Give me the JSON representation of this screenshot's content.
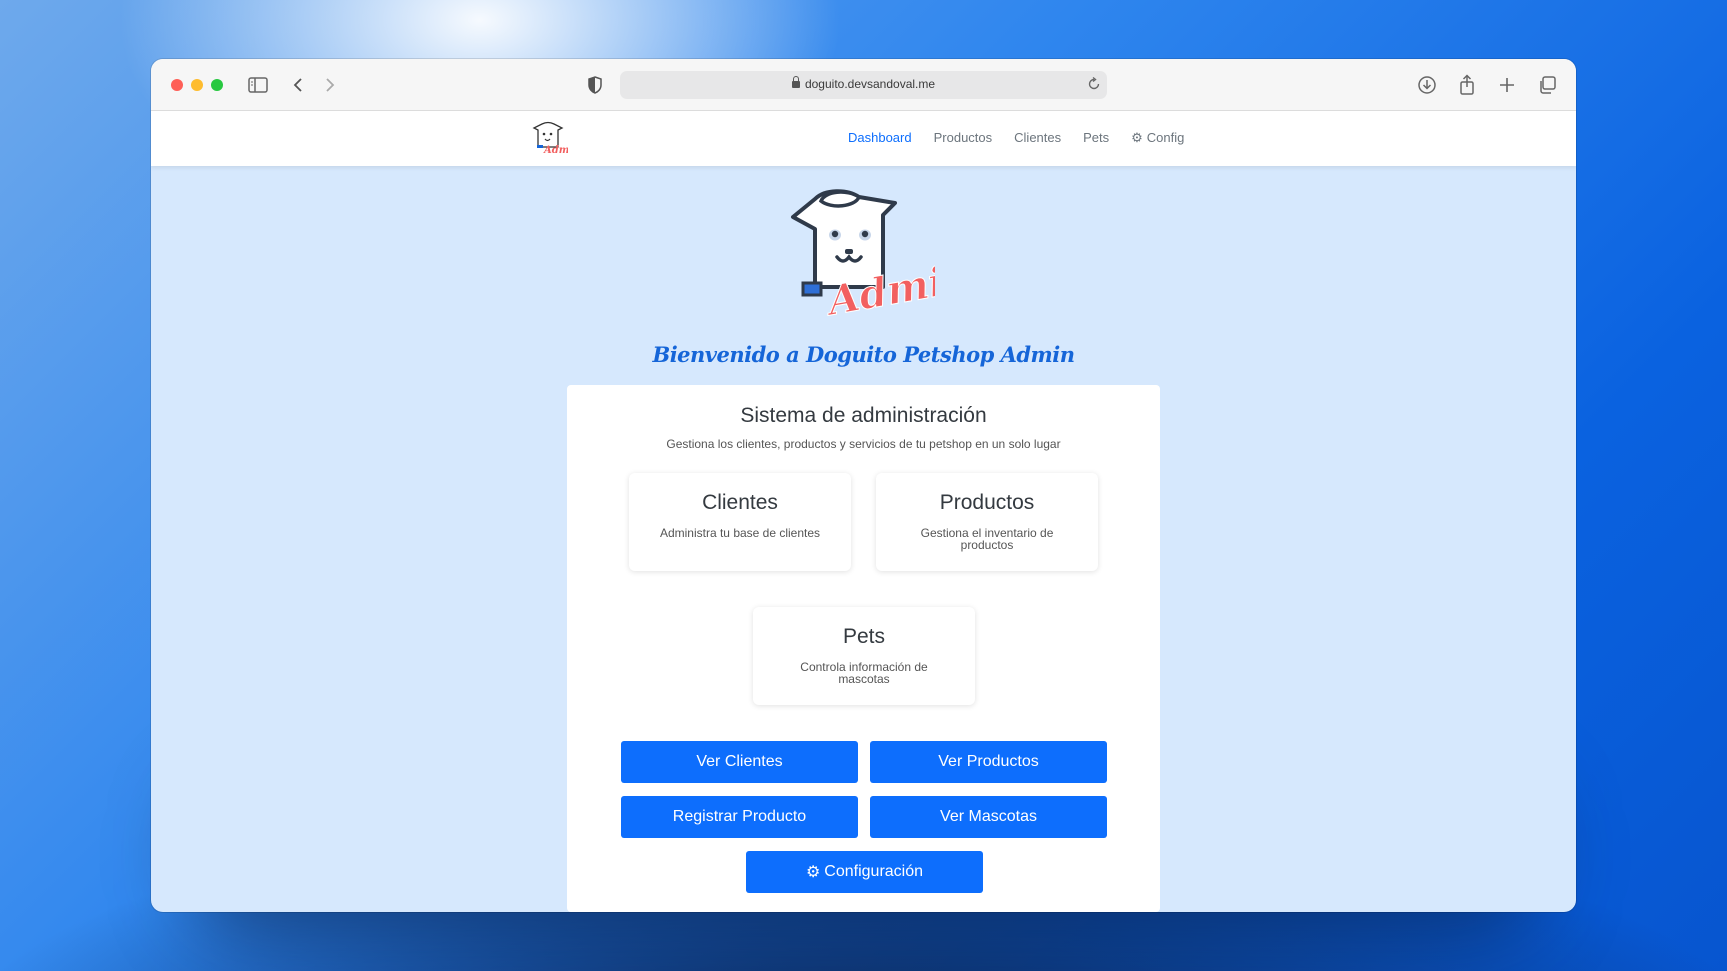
{
  "browser": {
    "url": "doguito.devsandoval.me"
  },
  "nav": {
    "logo_alt": "Doguito Admin",
    "links": [
      "Dashboard",
      "Productos",
      "Clientes",
      "Pets",
      "Config"
    ],
    "active": "Dashboard"
  },
  "hero": {
    "logo_text": "Admin",
    "welcome": "Bienvenido a Doguito Petshop Admin"
  },
  "card": {
    "title": "Sistema de administración",
    "subtitle": "Gestiona los clientes, productos y servicios de tu petshop en un solo lugar",
    "sections": [
      {
        "title": "Clientes",
        "desc": "Administra tu base de clientes"
      },
      {
        "title": "Productos",
        "desc": "Gestiona el inventario de productos"
      },
      {
        "title": "Pets",
        "desc": "Controla información de mascotas"
      }
    ],
    "buttons": {
      "ver_clientes": "Ver Clientes",
      "ver_productos": "Ver Productos",
      "registrar_producto": "Registrar Producto",
      "ver_mascotas": "Ver Mascotas",
      "configuracion": "Configuración"
    }
  },
  "colors": {
    "accent": "#0d6efd",
    "page_bg": "#d6e8fd",
    "logo_red": "#f26060"
  }
}
